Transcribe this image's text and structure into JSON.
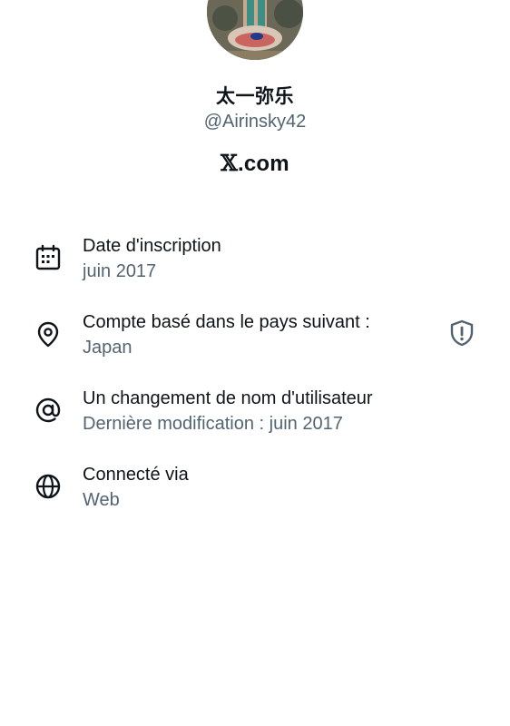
{
  "profile": {
    "display_name": "太一弥乐",
    "handle": "@Airinsky42",
    "site_logo_mark": "𝕏",
    "site_logo_text": ".com"
  },
  "info_rows": [
    {
      "icon": "calendar-icon",
      "title": "Date d'inscription",
      "value": "juin 2017"
    },
    {
      "icon": "location-pin-icon",
      "title": "Compte basé dans le pays suivant :",
      "value": "Japan",
      "trailing_icon": "shield-alert-icon"
    },
    {
      "icon": "at-sign-icon",
      "title": "Un changement de nom d'utilisateur",
      "value": "Dernière modification : juin 2017"
    },
    {
      "icon": "globe-icon",
      "title": "Connecté via",
      "value": "Web"
    }
  ],
  "colors": {
    "primary_text": "#0f1419",
    "secondary_text": "#536471",
    "background": "#ffffff"
  }
}
